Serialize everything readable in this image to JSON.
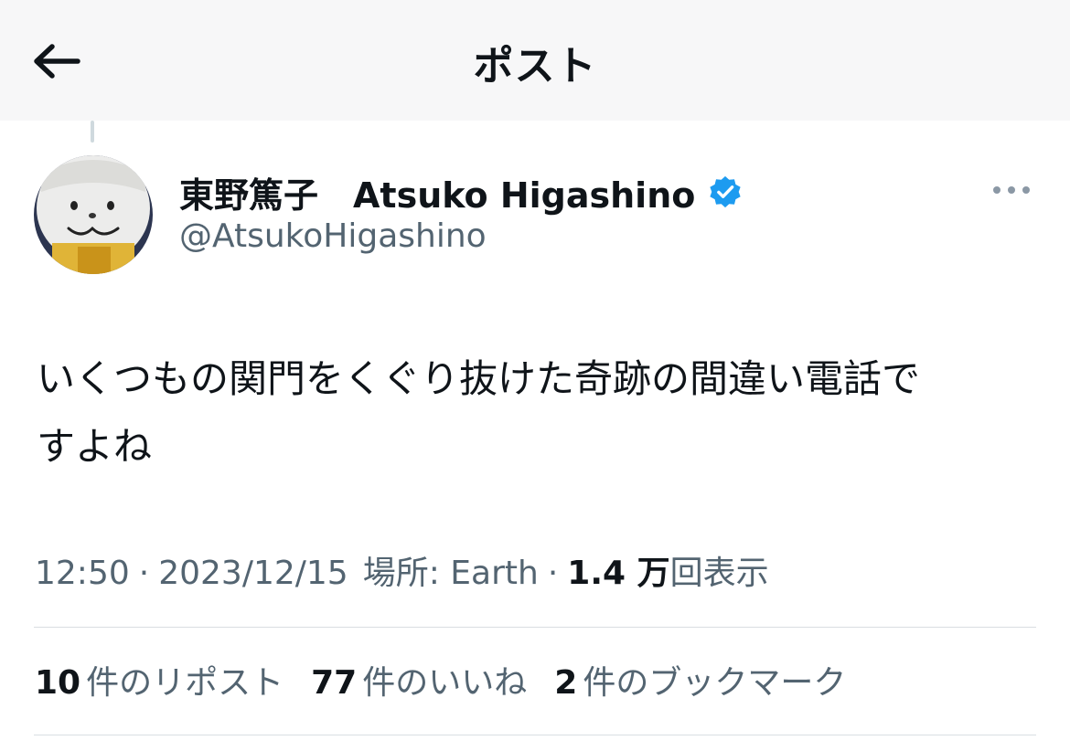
{
  "header": {
    "title": "ポスト",
    "back_icon": "arrow-left-icon"
  },
  "author": {
    "display_name": "東野篤子　Atsuko Higashino",
    "handle": "@AtsukoHigashino",
    "verified_color": "#1d9bf0",
    "verified_icon": "verified-badge-icon",
    "more_icon": "more-horizontal-icon"
  },
  "tweet": {
    "text_line1": "いくつもの関門をくぐり抜けた奇跡の間違い電話で",
    "text_line2": "すよね"
  },
  "meta": {
    "time": "12:50",
    "sep1": "·",
    "date": "2023/12/15",
    "location": "場所: Earth",
    "sep2": "·",
    "views_count": "1.4 万",
    "views_label": "回表示"
  },
  "stats": {
    "reposts_count": "10",
    "reposts_label": "件のリポスト",
    "likes_count": "77",
    "likes_label": "件のいいね",
    "bookmarks_count": "2",
    "bookmarks_label": "件のブックマーク"
  }
}
